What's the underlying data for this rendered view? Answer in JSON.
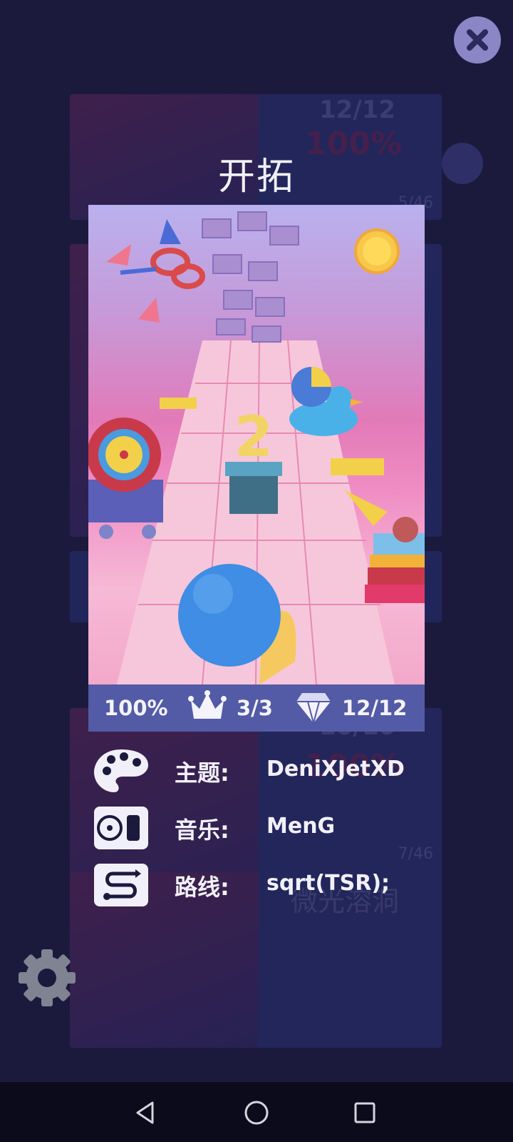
{
  "level": {
    "title": "开拓",
    "stats": {
      "percent": "100%",
      "crowns": "3/3",
      "gems": "12/12"
    }
  },
  "info": {
    "theme_label": "主题:",
    "theme_value": "DeniXJetXD",
    "music_label": "音乐:",
    "music_value": "MenG",
    "route_label": "路线:",
    "route_value": "sqrt(TSR);"
  },
  "background_list": {
    "card1": {
      "gems": "12/12",
      "percent": "100%",
      "count": "5/46"
    },
    "card2": {
      "gems": "10/10",
      "percent": "100%",
      "count": "7/46",
      "title": "微光溶洞"
    }
  },
  "preview_scene": {
    "counter_digit": "2"
  },
  "icons": {
    "close": "close-icon",
    "crown": "crown-icon",
    "gem": "gem-icon",
    "palette": "palette-icon",
    "music": "music-player-icon",
    "route": "route-icon",
    "settings": "gear-icon",
    "back": "back-triangle-icon",
    "home": "home-circle-icon",
    "recents": "recents-square-icon"
  },
  "colors": {
    "background": "#1b1a3d",
    "stats_bar": "#535ba6",
    "close_button": "#8b86c6",
    "text": "#f1f0fa",
    "ball": "#3f8de4"
  }
}
